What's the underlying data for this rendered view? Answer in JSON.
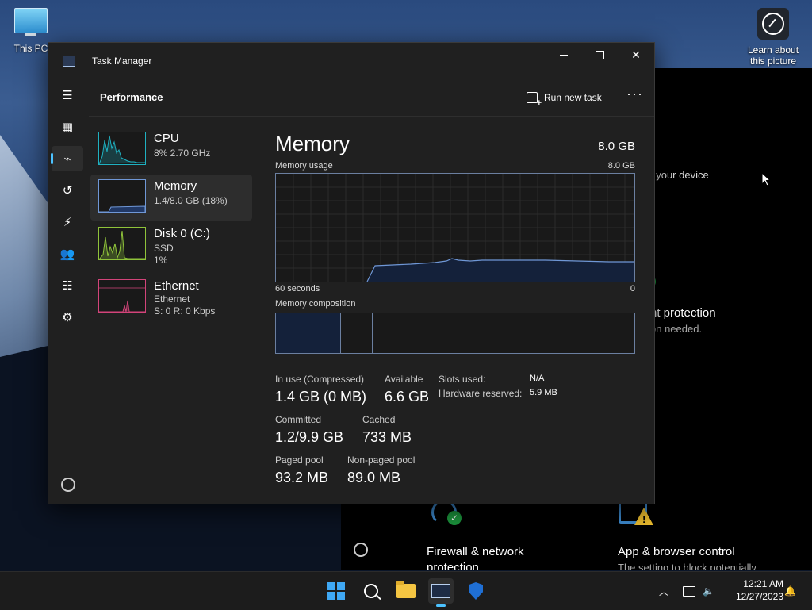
{
  "desktop": {
    "icons": [
      {
        "label": "This PC",
        "icon": "monitor-icon"
      },
      {
        "label": "Learn about this picture",
        "icon": "camera-icon"
      }
    ]
  },
  "background_window": {
    "texts": {
      "device": "f your device",
      "protection": "nt protection",
      "action": "on needed.",
      "firewall": "Firewall & network",
      "firewall2": "protection",
      "app": "App & browser control",
      "app_sub": "The setting to block potentially"
    }
  },
  "window": {
    "title": "Task Manager",
    "header": {
      "title": "Performance",
      "run_task": "Run new task",
      "more": "···"
    },
    "nav": [
      {
        "icon": "hamburger-icon",
        "glyph": "☰"
      },
      {
        "icon": "processes-icon",
        "glyph": "▦"
      },
      {
        "icon": "performance-icon",
        "glyph": "⌁",
        "active": true
      },
      {
        "icon": "app-history-icon",
        "glyph": "↺"
      },
      {
        "icon": "startup-apps-icon",
        "glyph": "⚡"
      },
      {
        "icon": "users-icon",
        "glyph": "👥"
      },
      {
        "icon": "details-icon",
        "glyph": "☷"
      },
      {
        "icon": "services-icon",
        "glyph": "⚙"
      }
    ],
    "sidebar": [
      {
        "name": "CPU",
        "line1": "8% 2.70 GHz",
        "line2": "",
        "color": "#1fb1c1"
      },
      {
        "name": "Memory",
        "line1": "1.4/8.0 GB (18%)",
        "line2": "",
        "color": "#6f97d6",
        "selected": true
      },
      {
        "name": "Disk 0 (C:)",
        "line1": "SSD",
        "line2": "1%",
        "color": "#8fc33a"
      },
      {
        "name": "Ethernet",
        "line1": "Ethernet",
        "line2": "S: 0 R: 0 Kbps",
        "color": "#d3447a"
      }
    ],
    "main": {
      "title": "Memory",
      "total": "8.0 GB",
      "usage_label": "Memory usage",
      "usage_max": "8.0 GB",
      "time_left": "60 seconds",
      "time_right": "0",
      "composition_label": "Memory composition",
      "stats": {
        "in_use_label": "In use (Compressed)",
        "in_use_value": "1.4 GB (0 MB)",
        "available_label": "Available",
        "available_value": "6.6 GB",
        "committed_label": "Committed",
        "committed_value": "1.2/9.9 GB",
        "cached_label": "Cached",
        "cached_value": "733 MB",
        "paged_label": "Paged pool",
        "paged_value": "93.2 MB",
        "nonpaged_label": "Non-paged pool",
        "nonpaged_value": "89.0 MB",
        "slots_label": "Slots used:",
        "slots_value": "N/A",
        "hw_label": "Hardware reserved:",
        "hw_value": "5.9 MB"
      }
    }
  },
  "taskbar": {
    "time": "12:21 AM",
    "date": "12/27/2023"
  }
}
